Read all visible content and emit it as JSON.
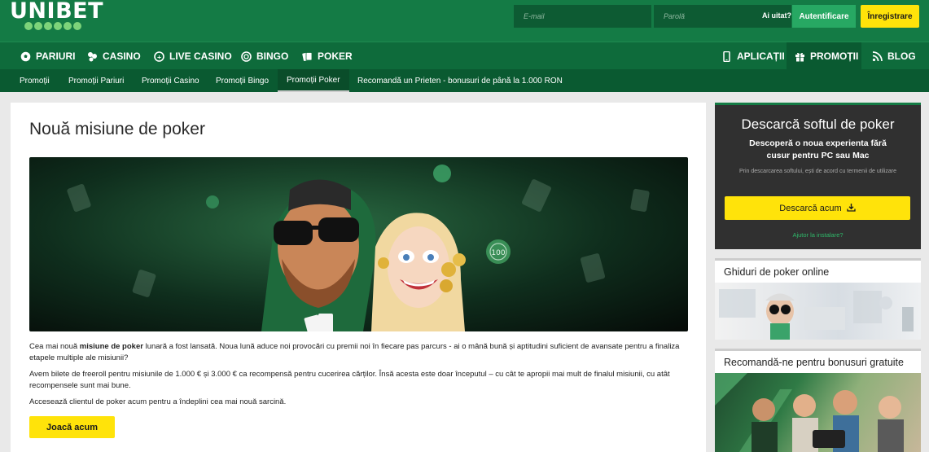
{
  "brand": {
    "logo_text": "UNIBET"
  },
  "login": {
    "email_placeholder": "E-mail",
    "password_placeholder": "Parolă",
    "forgot_label": "Ai uitat?",
    "login_button": "Autentificare",
    "register_button": "Înregistrare"
  },
  "main_nav": {
    "left": [
      {
        "label": "PARIURI",
        "icon": "soccer-ball-icon"
      },
      {
        "label": "CASINO",
        "icon": "casino-icon"
      },
      {
        "label": "LIVE CASINO",
        "icon": "live-casino-icon"
      },
      {
        "label": "BINGO",
        "icon": "bingo-icon"
      },
      {
        "label": "POKER",
        "icon": "cards-icon"
      }
    ],
    "right": [
      {
        "label": "APLICAȚII",
        "icon": "mobile-icon"
      },
      {
        "label": "PROMOȚII",
        "icon": "gift-icon",
        "active": true
      },
      {
        "label": "BLOG",
        "icon": "rss-icon"
      }
    ]
  },
  "sub_nav": [
    {
      "label": "Promoții"
    },
    {
      "label": "Promoții Pariuri"
    },
    {
      "label": "Promoții Casino"
    },
    {
      "label": "Promoții Bingo"
    },
    {
      "label": "Promoții Poker",
      "active": true
    },
    {
      "label": "Recomandă un Prieten - bonusuri de până la 1.000 RON"
    }
  ],
  "article": {
    "title": "Nouă misiune de poker",
    "hero_chip_text": "100",
    "p1_before": "Cea mai nouă ",
    "p1_bold": "misiune de poker",
    "p1_after": " lunară a fost lansată. Noua lună aduce noi provocări cu premii noi în fiecare pas parcurs - ai o mână bună și aptitudini suficient de avansate pentru a finaliza etapele multiple ale misiunii?",
    "p2": "Avem bilete de freeroll pentru misiunile de 1.000 € și 3.000 € ca recompensă pentru cucerirea cărților. Însă acesta este doar începutul – cu cât te apropii mai mult de finalul misiunii, cu atât recompensele sunt mai bune.",
    "p3": "Accesează clientul de poker acum pentru a îndeplini cea mai nouă sarcină.",
    "play_button": "Joacă acum"
  },
  "sidebar": {
    "download": {
      "title": "Descarcă softul de poker",
      "subtitle": "Descoperă o noua experienta fără cusur pentru PC sau Mac",
      "terms": "Prin descarcarea softului, ești de acord cu termenii de utilizare",
      "button": "Descarcă acum",
      "help": "Ajutor la instalare?"
    },
    "guides_title": "Ghiduri de poker online",
    "recommend_title": "Recomandă-ne pentru bonusuri gratuite"
  },
  "colors": {
    "brand_green": "#147b45",
    "nav_green": "#0e6b3b",
    "accent_yellow": "#ffe30a"
  }
}
